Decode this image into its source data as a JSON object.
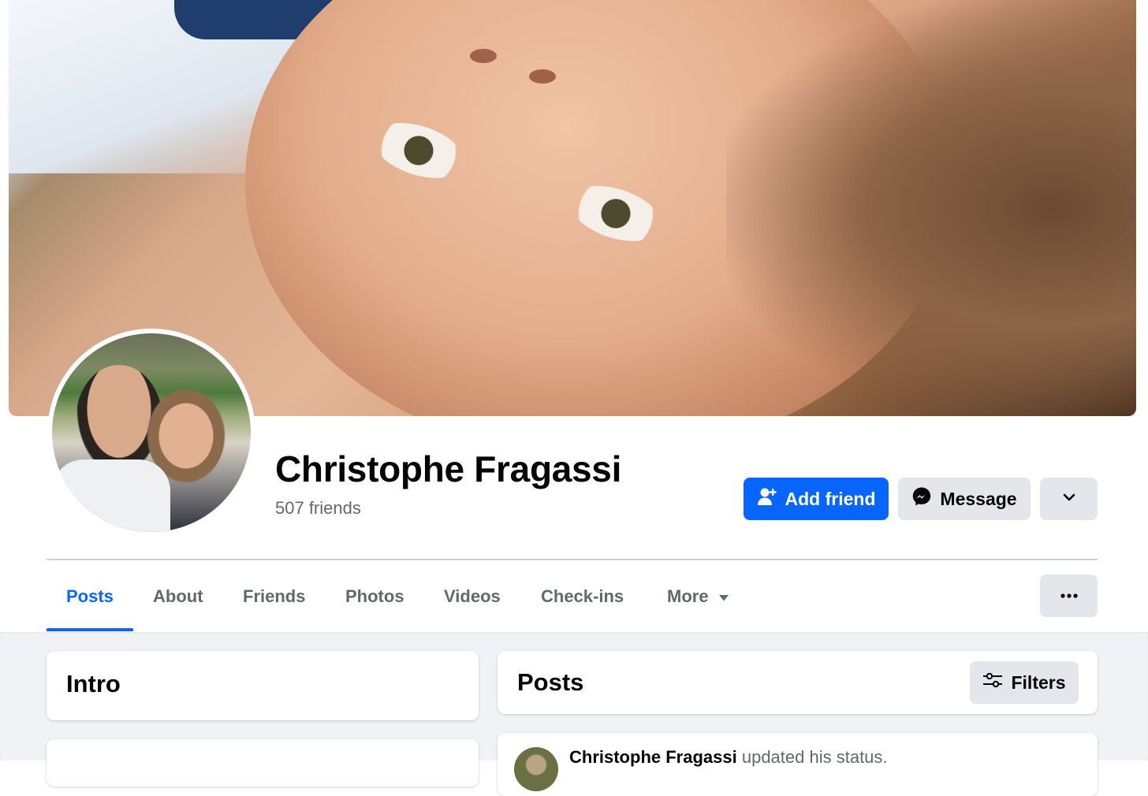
{
  "profile": {
    "name": "Christophe Fragassi",
    "friends_count": "507 friends"
  },
  "actions": {
    "add_friend": "Add friend",
    "message": "Message"
  },
  "tabs": [
    {
      "label": "Posts",
      "active": true
    },
    {
      "label": "About"
    },
    {
      "label": "Friends"
    },
    {
      "label": "Photos"
    },
    {
      "label": "Videos"
    },
    {
      "label": "Check-ins"
    },
    {
      "label": "More"
    }
  ],
  "intro": {
    "title": "Intro"
  },
  "posts": {
    "title": "Posts",
    "filters_label": "Filters",
    "first_post": {
      "author": "Christophe Fragassi",
      "action": "updated his status."
    }
  },
  "colors": {
    "accent": "#0866ff",
    "button_gray": "#e4e6eb",
    "muted_text": "#65676b",
    "page_bg": "#f0f2f5"
  }
}
